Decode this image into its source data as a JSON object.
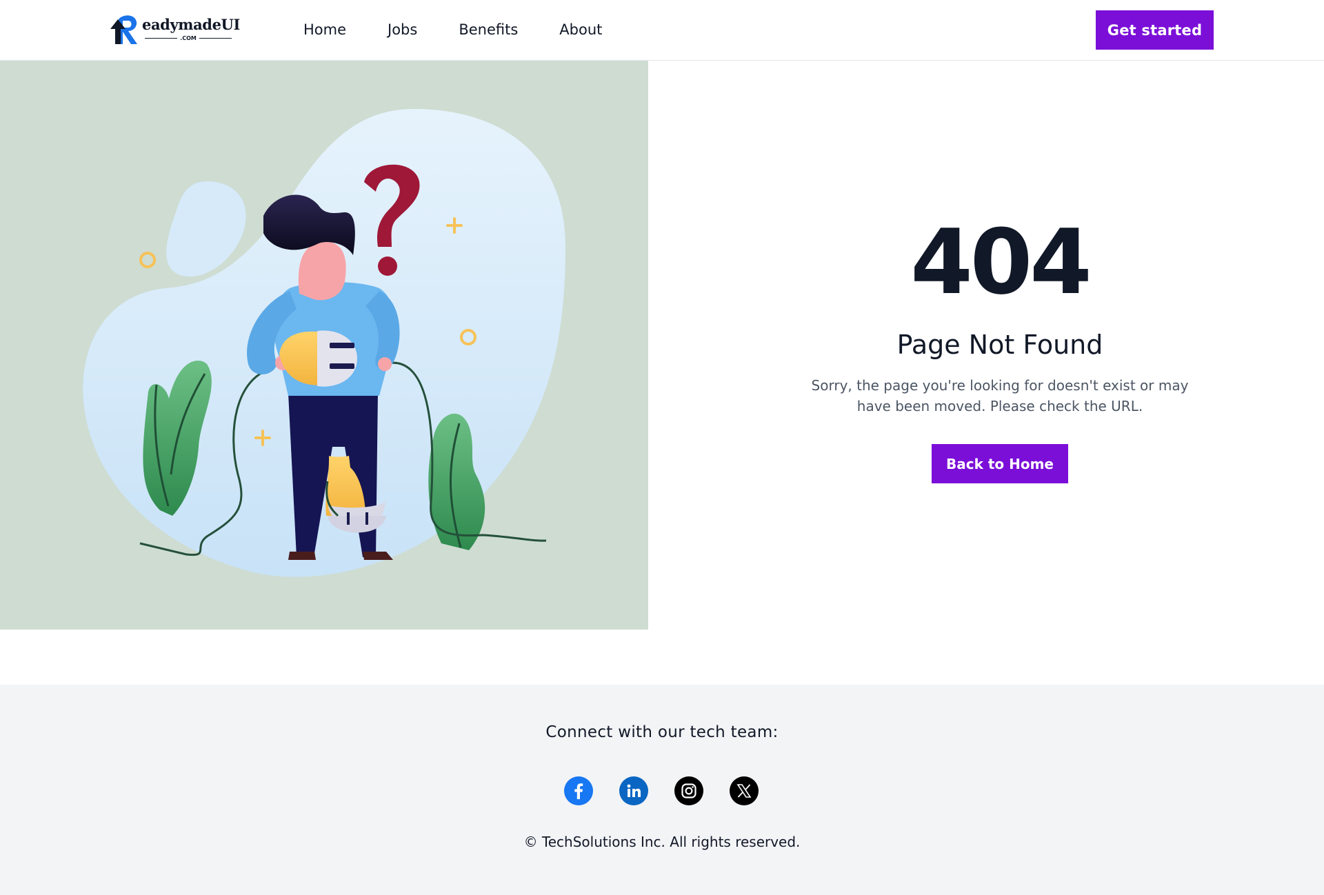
{
  "header": {
    "logo": {
      "brand": "eadymadeUI",
      "initial": "R",
      "suffix": ".COM"
    },
    "nav": [
      {
        "label": "Home"
      },
      {
        "label": "Jobs"
      },
      {
        "label": "Benefits"
      },
      {
        "label": "About"
      }
    ],
    "cta_label": "Get started"
  },
  "error": {
    "code": "404",
    "title": "Page Not Found",
    "message": "Sorry, the page you're looking for doesn't exist or may have been moved. Please check the URL.",
    "button_label": "Back to Home"
  },
  "illustration": {
    "subject": "person holding unplugged cable with question mark",
    "background_color": "#cedcd2"
  },
  "footer": {
    "heading": "Connect with our tech team:",
    "socials": [
      {
        "icon": "facebook-icon",
        "color": "#1877f2"
      },
      {
        "icon": "linkedin-icon",
        "color": "#0a66c2"
      },
      {
        "icon": "instagram-icon",
        "color": "#000000"
      },
      {
        "icon": "x-icon",
        "color": "#000000"
      }
    ],
    "copyright": "© TechSolutions Inc. All rights reserved."
  },
  "colors": {
    "accent": "#7b0fd8",
    "text": "#111827",
    "muted": "#4b5563",
    "footer_bg": "#f3f4f6"
  }
}
